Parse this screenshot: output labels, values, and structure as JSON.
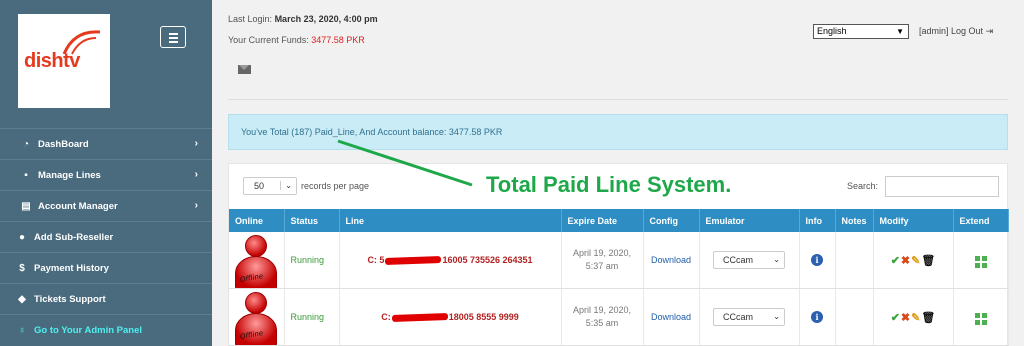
{
  "header": {
    "last_login_label": "Last Login:",
    "last_login_value": "March 23, 2020, 4:00 pm",
    "funds_label": "Your Current Funds:",
    "funds_value": "3477.58 PKR",
    "language": "English",
    "logout": "[admin] Log Out"
  },
  "sidebar": {
    "logo": "dishtv",
    "items": [
      {
        "label": "DashBoard"
      },
      {
        "label": "Manage Lines"
      },
      {
        "label": "Account Manager"
      },
      {
        "label": "Add Sub-Reseller"
      },
      {
        "label": "Payment History"
      },
      {
        "label": "Tickets Support"
      },
      {
        "label": "Go to Your Admin Panel"
      }
    ]
  },
  "alert": "You've Total (187) Paid_Line, And Account balance: 3477.58 PKR",
  "annotation": "Total Paid Line System.",
  "table_controls": {
    "page_length": "50",
    "records_per_page": "records per page",
    "search_label": "Search:"
  },
  "table": {
    "columns": [
      "Online",
      "Status",
      "Line",
      "Expire Date",
      "Config",
      "Emulator",
      "Info",
      "Notes",
      "Modify",
      "Extend"
    ],
    "rows": [
      {
        "online": "Offline",
        "status": "Running",
        "line_prefix": "C: 5",
        "line_suffix": "16005 735526 264351",
        "expire_date": "April 19, 2020,",
        "expire_time": "5:37 am",
        "config": "Download",
        "emulator": "CCcam"
      },
      {
        "online": "Offline",
        "status": "Running",
        "line_prefix": "C:",
        "line_suffix": "18005 8555 9999",
        "expire_date": "April 19, 2020,",
        "expire_time": "5:35 am",
        "config": "Download",
        "emulator": "CCcam"
      }
    ]
  }
}
